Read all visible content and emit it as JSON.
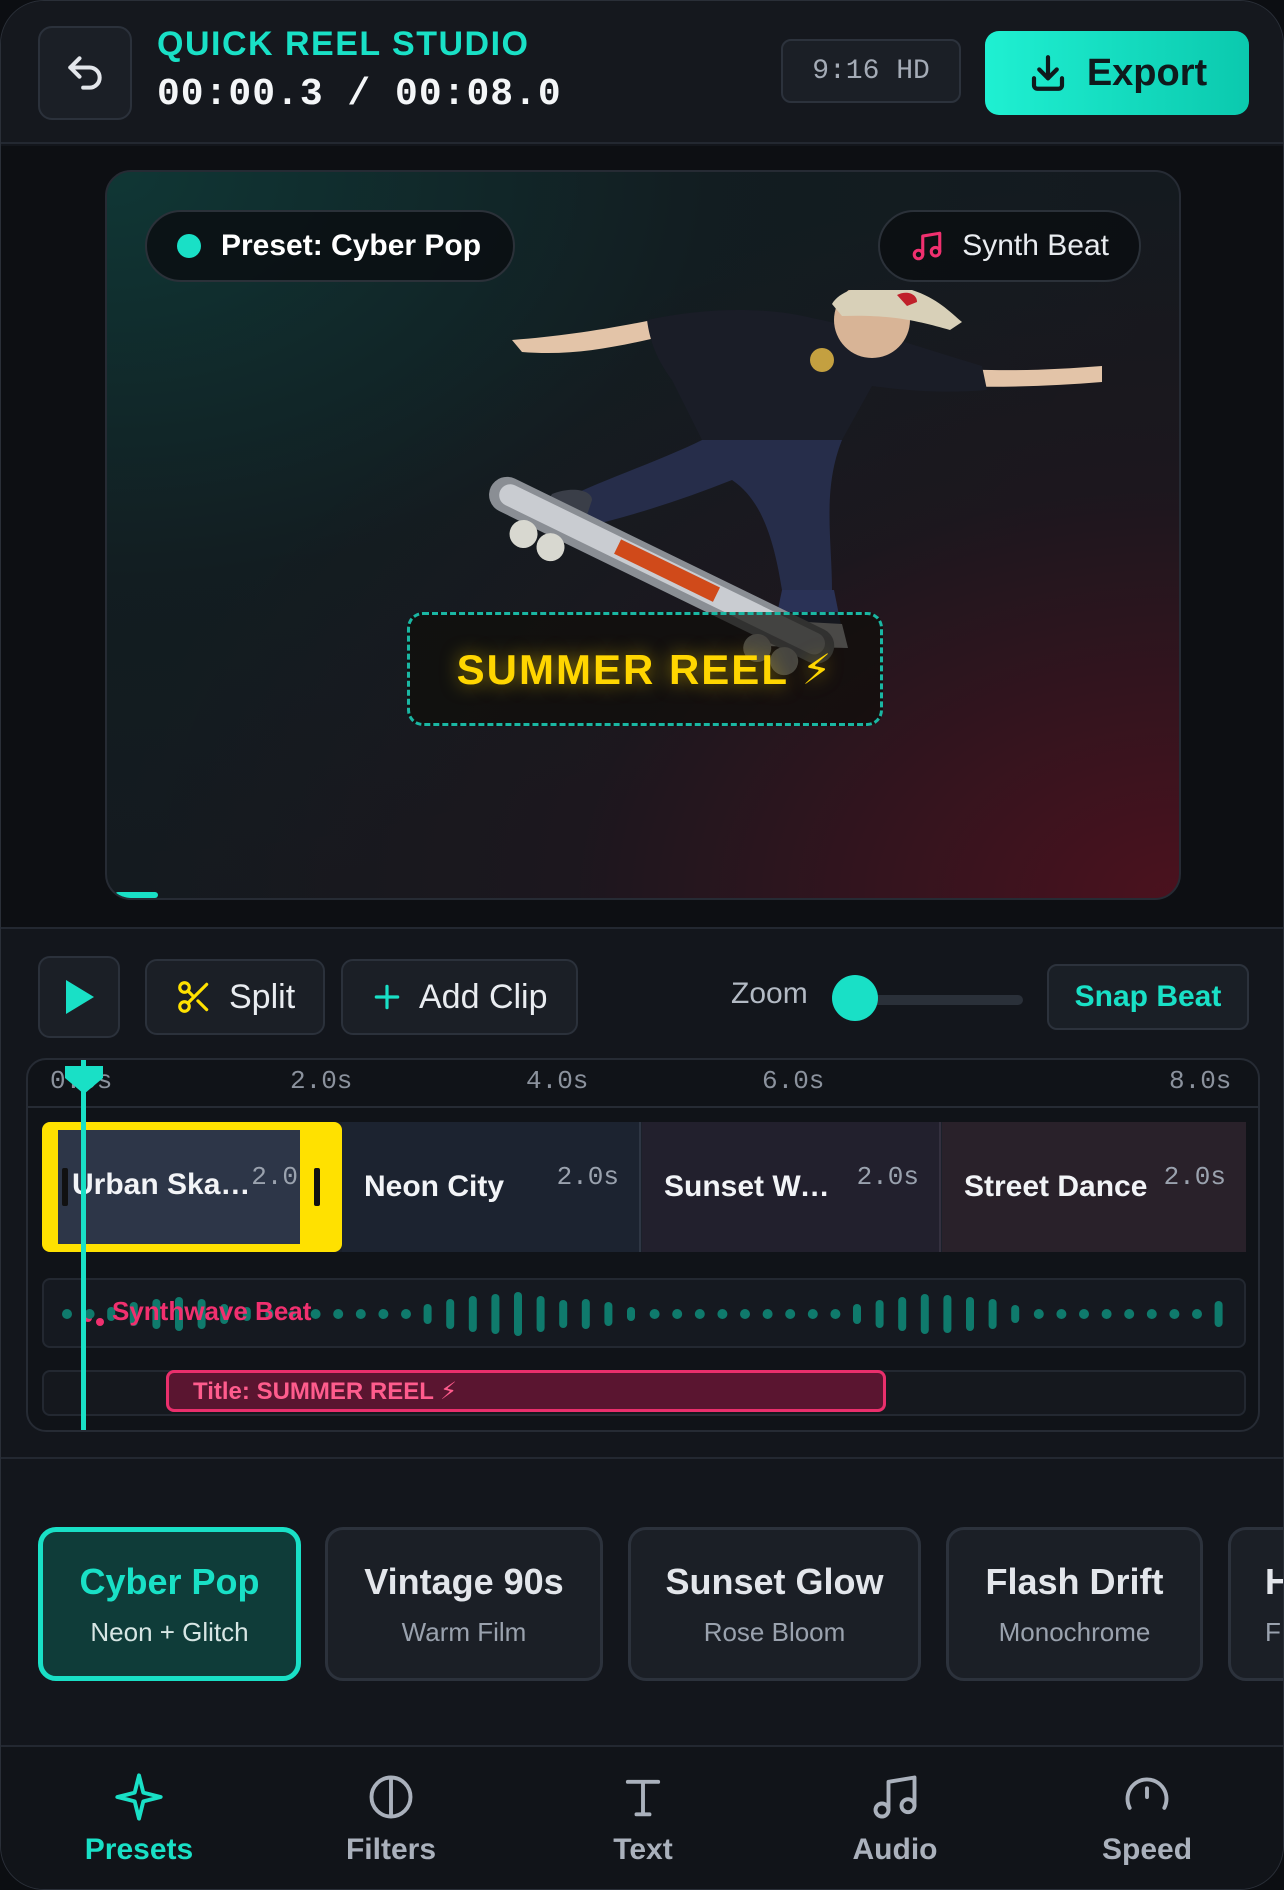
{
  "header": {
    "app_title": "QUICK REEL STUDIO",
    "timecode": "00:00.3 / 00:08.0",
    "format": "9:16 HD",
    "export_label": "Export"
  },
  "preview": {
    "preset_label": "Preset: Cyber Pop",
    "music_label": "Synth Beat",
    "title_overlay": "SUMMER REEL ⚡",
    "playback_progress": 0.04
  },
  "controls": {
    "split_label": "Split",
    "add_clip_label": "Add Clip",
    "zoom_label": "Zoom",
    "zoom_level": 0.0,
    "snap_label": "Snap Beat"
  },
  "timeline": {
    "ticks": [
      "0.0s",
      "2.0s",
      "4.0s",
      "6.0s",
      "8.0s"
    ],
    "clips": [
      {
        "name": "Urban Ska…",
        "duration": "2.0",
        "selected": true
      },
      {
        "name": "Neon City",
        "duration": "2.0s"
      },
      {
        "name": "Sunset Wa…",
        "duration": "2.0s"
      },
      {
        "name": "Street Dance",
        "duration": "2.0s"
      }
    ],
    "audio_label": "Synthwave Beat",
    "text_clip_label": "Title: SUMMER REEL ⚡",
    "playhead_time": "00:00.3"
  },
  "presets": [
    {
      "name": "Cyber Pop",
      "sub": "Neon + Glitch",
      "active": true
    },
    {
      "name": "Vintage 90s",
      "sub": "Warm Film"
    },
    {
      "name": "Sunset Glow",
      "sub": "Rose Bloom"
    },
    {
      "name": "Flash Drift",
      "sub": "Monochrome"
    },
    {
      "name": "H",
      "sub": "F"
    }
  ],
  "nav": [
    {
      "label": "Presets",
      "icon": "sparkle-icon",
      "active": true
    },
    {
      "label": "Filters",
      "icon": "filter-circle-icon"
    },
    {
      "label": "Text",
      "icon": "text-icon"
    },
    {
      "label": "Audio",
      "icon": "music-note-icon"
    },
    {
      "label": "Speed",
      "icon": "speedometer-icon"
    }
  ],
  "colors": {
    "accent": "#19e0c6",
    "highlight": "#ffe100",
    "title_pink": "#ea2f6c"
  }
}
